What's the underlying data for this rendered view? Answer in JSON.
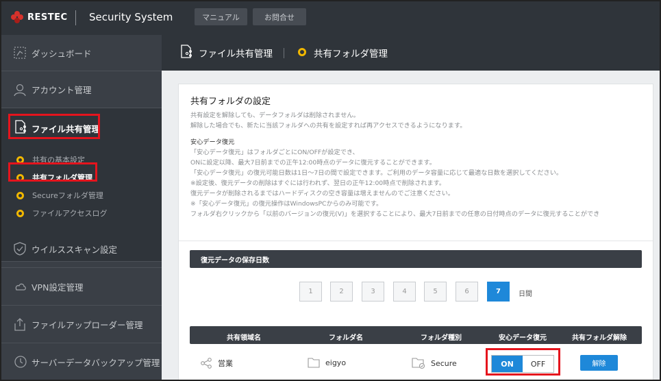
{
  "header": {
    "brand": "RESTEC",
    "system_title": "Security System",
    "buttons": [
      "マニュアル",
      "お問合せ"
    ]
  },
  "sidebar": {
    "items": [
      {
        "label": "ダッシュボード",
        "icon": "dashboard-icon"
      },
      {
        "label": "アカウント管理",
        "icon": "user-icon"
      },
      {
        "label": "ファイル共有管理",
        "icon": "file-share-icon"
      },
      {
        "label": "ウイルススキャン設定",
        "icon": "shield-icon"
      },
      {
        "label": "VPN設定管理",
        "icon": "cloud-icon"
      },
      {
        "label": "ファイルアップローダー管理",
        "icon": "upload-icon"
      },
      {
        "label": "サーバーデータバックアップ管理",
        "icon": "history-icon"
      }
    ],
    "subitems": [
      "共有の基本設定",
      "共有フォルダ管理",
      "Secureフォルダ管理",
      "ファイルアクセスログ"
    ]
  },
  "content_header": {
    "section": "ファイル共有管理",
    "page": "共有フォルダ管理"
  },
  "panel": {
    "title": "共有フォルダの設定",
    "notes": [
      "共有設定を解除しても、データフォルダは削除されません。",
      "解除した場合でも、新たに当該フォルダへの共有を設定すれば再アクセスできるようになります。"
    ],
    "recovery_head": "安心データ復元",
    "recovery_notes": [
      "「安心データ復元」はフォルダごとにON/OFFが設定でき、",
      "ONに設定以降、最大7日前までの正午12:00時点のデータに復元することができます。",
      "「安心データ復元」の復元可能日数は1日〜7日の間で設定できます。ご利用のデータ容量に応じて最適な日数を選択してください。",
      "※設定後、復元データの削除はすぐには行われず、翌日の正午12:00時点で削除されます。",
      "復元データが削除されるまではハードディスクの空き容量は増えませんのでご注意ください。",
      "※「安心データ復元」の復元操作はWindowsPCからのみ可能です。",
      "フォルダ右クリックから「以前のバージョンの復元(V)」を選択することにより、最大7日前までの任意の日付時点のデータに復元することができ"
    ],
    "retention_label": "復元データの保存日数",
    "days": [
      "1",
      "2",
      "3",
      "4",
      "5",
      "6",
      "7"
    ],
    "selected_day": "7",
    "day_unit": "日間",
    "table": {
      "headers": [
        "共有領域名",
        "フォルダ名",
        "フォルダ種別",
        "安心データ復元",
        "共有フォルダ解除"
      ],
      "rows": [
        {
          "area": "営業",
          "folder": "eigyo",
          "type": "Secure",
          "toggle_on": "ON",
          "toggle_off": "OFF",
          "release": "解除"
        }
      ]
    }
  },
  "colors": {
    "accent": "#1e88d9",
    "highlight": "#e5141d",
    "bullet": "#f1b700",
    "dark": "#2f343a"
  }
}
